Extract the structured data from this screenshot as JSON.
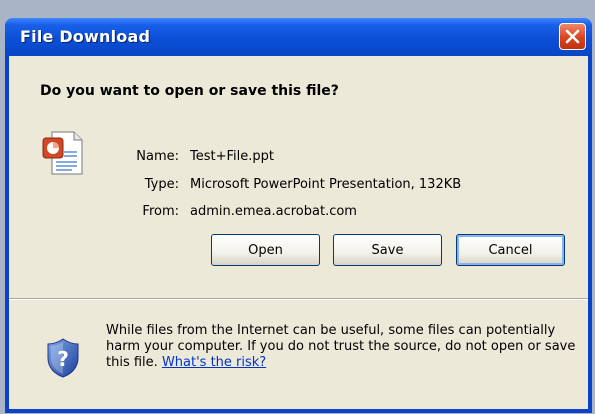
{
  "window": {
    "title": "File Download"
  },
  "dialog": {
    "question": "Do you want to open or save this file?",
    "fields": [
      {
        "label": "Name:",
        "value": "Test+File.ppt"
      },
      {
        "label": "Type:",
        "value": "Microsoft PowerPoint Presentation, 132KB"
      },
      {
        "label": "From:",
        "value": "admin.emea.acrobat.com"
      }
    ],
    "buttons": {
      "open": "Open",
      "save": "Save",
      "cancel": "Cancel"
    },
    "warning": {
      "text": "While files from the Internet can be useful, some files can potentially harm your computer. If you do not trust the source, do not open or save this file.",
      "link": "What's the risk?"
    }
  },
  "icons": {
    "file": "powerpoint-file-icon",
    "warning": "security-shield-icon",
    "close": "close-icon"
  },
  "colors": {
    "titlebar": "#0a45c6",
    "client_bg": "#ece9d8",
    "close_button": "#d9441e",
    "link": "#0033cc"
  }
}
